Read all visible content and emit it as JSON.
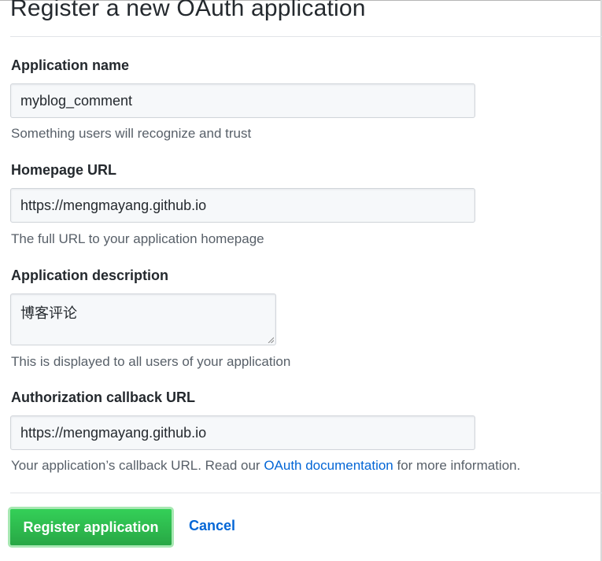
{
  "page_title": "Register a new OAuth application",
  "fields": {
    "app_name": {
      "label": "Application name",
      "value": "myblog_comment",
      "note": "Something users will recognize and trust"
    },
    "homepage_url": {
      "label": "Homepage URL",
      "value": "https://mengmayang.github.io",
      "note": "The full URL to your application homepage"
    },
    "description": {
      "label": "Application description",
      "value": "博客评论",
      "note": "This is displayed to all users of your application"
    },
    "callback_url": {
      "label": "Authorization callback URL",
      "value": "https://mengmayang.github.io",
      "note_before": "Your application’s callback URL. Read our ",
      "note_link": "OAuth documentation",
      "note_after": " for more information."
    }
  },
  "actions": {
    "register_label": "Register application",
    "cancel_label": "Cancel"
  },
  "colors": {
    "primary_green": "#28a745",
    "link_blue": "#0366d6"
  }
}
